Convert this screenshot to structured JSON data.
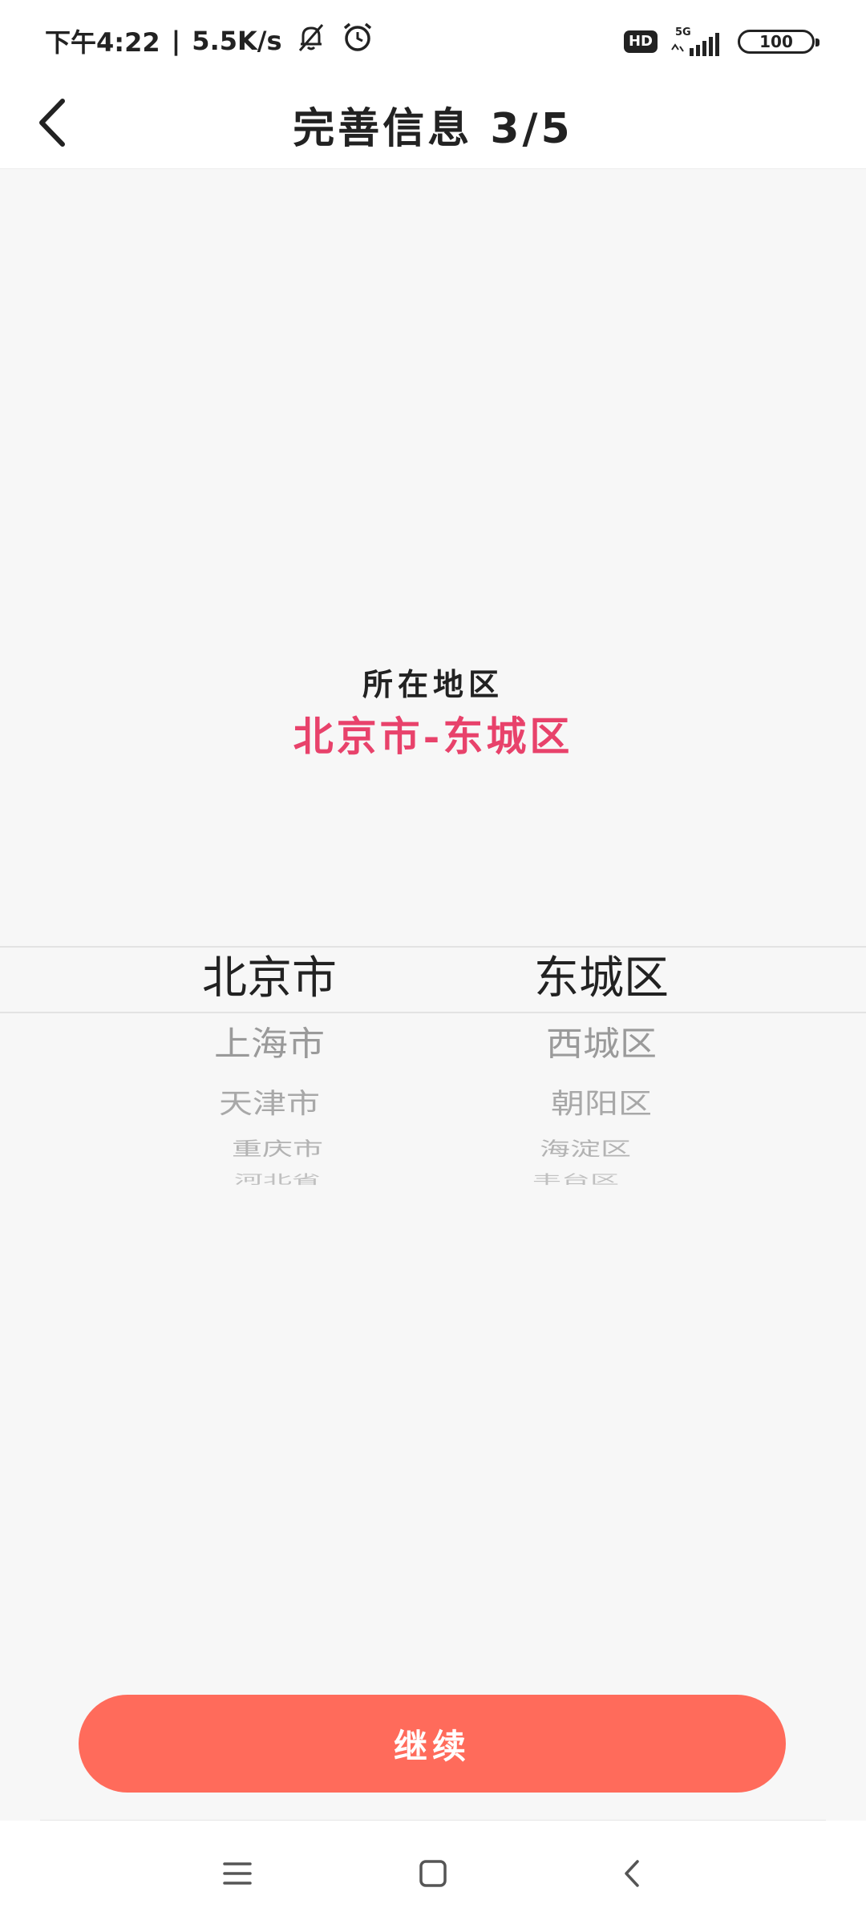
{
  "status_bar": {
    "time": "下午4:22",
    "network_speed": "5.5K/s",
    "hd": "HD",
    "signal": "5G",
    "battery": "100"
  },
  "header": {
    "title": "完善信息 3/5"
  },
  "region": {
    "label": "所在地区",
    "value": "北京市-东城区"
  },
  "picker": {
    "provinces": [
      "北京市",
      "上海市",
      "天津市",
      "重庆市",
      "河北省"
    ],
    "districts": [
      "东城区",
      "西城区",
      "朝阳区",
      "海淀区",
      "丰台区"
    ]
  },
  "actions": {
    "continue_label": "继续"
  },
  "colors": {
    "accent": "#ff6b5b",
    "region_value": "#e8426b"
  },
  "icons": {
    "back": "chevron-left-icon",
    "mute": "bell-off-icon",
    "alarm": "alarm-icon",
    "nav_menu": "menu-icon",
    "nav_home": "home-square-icon",
    "nav_back": "back-chevron-icon"
  }
}
